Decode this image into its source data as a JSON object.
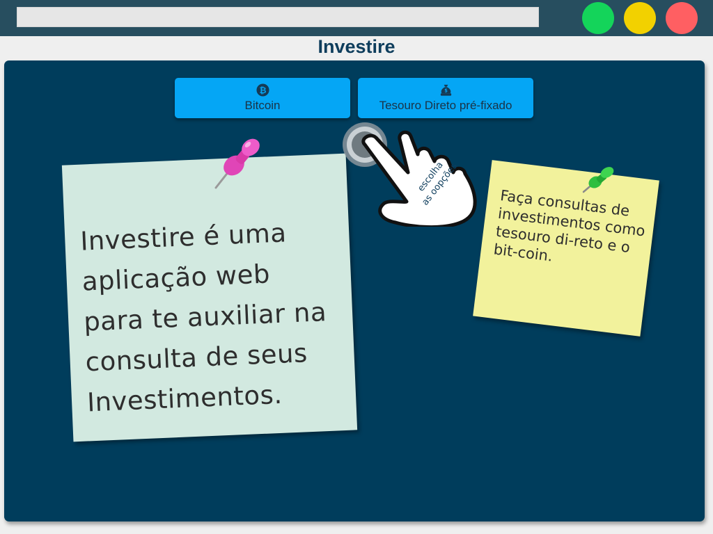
{
  "window": {
    "address_bar": "",
    "controls": [
      {
        "name": "green",
        "color": "#14d45a"
      },
      {
        "name": "yellow",
        "color": "#f2d100"
      },
      {
        "name": "red",
        "color": "#ff5f62"
      }
    ]
  },
  "app": {
    "title": "Investire"
  },
  "options": [
    {
      "label": "Bitcoin",
      "icon": "bitcoin-icon"
    },
    {
      "label": "Tesouro Direto pré-fixado",
      "icon": "money-bag-icon"
    }
  ],
  "hint": {
    "line1": "escolha",
    "line2": "as oopções",
    "icon": "pointing-hand-icon"
  },
  "notes": {
    "intro": "Investire é uma aplicação web para te auxiliar na consulta de seus Investimentos.",
    "info": "Faça consultas de investimentos como tesouro di-reto e o bit-coin."
  },
  "colors": {
    "topbar": "#274e5f",
    "board": "#003d5c",
    "button": "#05a6f5",
    "note_intro": "#d2e9e0",
    "note_info": "#f2f29c",
    "title": "#0e3d5c"
  }
}
